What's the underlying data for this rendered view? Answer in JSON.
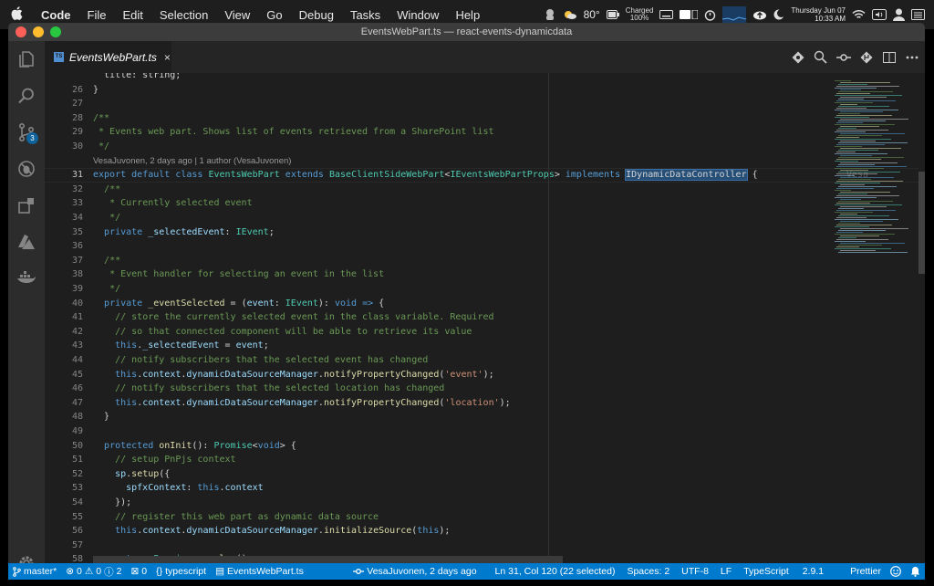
{
  "menubar": {
    "app": "Code",
    "items": [
      "File",
      "Edit",
      "Selection",
      "View",
      "Go",
      "Debug",
      "Tasks",
      "Window",
      "Help"
    ],
    "weather": "80°",
    "battery_status": "Charged",
    "battery_percent": "100%",
    "date": "Thursday Jun 07",
    "time": "10:33 AM"
  },
  "window": {
    "title": "EventsWebPart.ts — react-events-dynamicdata"
  },
  "activity": {
    "scm_badge": "3"
  },
  "tab": {
    "label": "EventsWebPart.ts",
    "icon_text": "TS",
    "close": "×"
  },
  "editor": {
    "codelens": "VesaJuvonen, 2 days ago | 1 author (VesaJuvonen)",
    "ghost_blame": "Vesa",
    "lines": [
      {
        "n": "",
        "tokens": [
          [
            "pu",
            "  title: string;"
          ]
        ]
      },
      {
        "n": "26",
        "tokens": [
          [
            "pu",
            "}"
          ]
        ]
      },
      {
        "n": "27",
        "tokens": []
      },
      {
        "n": "28",
        "tokens": [
          [
            "cm",
            "/**"
          ]
        ]
      },
      {
        "n": "29",
        "tokens": [
          [
            "cm",
            " * Events web part. Shows list of events retrieved from a SharePoint list"
          ]
        ]
      },
      {
        "n": "30",
        "tokens": [
          [
            "cm",
            " */"
          ]
        ]
      },
      {
        "n": "lens",
        "tokens": []
      },
      {
        "n": "31",
        "tokens": [
          [
            "kw",
            "export"
          ],
          [
            "pu",
            " "
          ],
          [
            "kw",
            "default"
          ],
          [
            "pu",
            " "
          ],
          [
            "kw",
            "class"
          ],
          [
            "pu",
            " "
          ],
          [
            "ty",
            "EventsWebPart"
          ],
          [
            "pu",
            " "
          ],
          [
            "kw",
            "extends"
          ],
          [
            "pu",
            " "
          ],
          [
            "ty",
            "BaseClientSideWebPart"
          ],
          [
            "pu",
            "<"
          ],
          [
            "ty",
            "IEventsWebPartProps"
          ],
          [
            "pu",
            "> "
          ],
          [
            "kw",
            "implements"
          ],
          [
            "pu",
            " "
          ],
          [
            "sel",
            "IDynamicDataController"
          ],
          [
            "pu",
            " {"
          ]
        ]
      },
      {
        "n": "32",
        "tokens": [
          [
            "pu",
            "  "
          ],
          [
            "cm",
            "/**"
          ]
        ]
      },
      {
        "n": "33",
        "tokens": [
          [
            "pu",
            "  "
          ],
          [
            "cm",
            " * Currently selected event"
          ]
        ]
      },
      {
        "n": "34",
        "tokens": [
          [
            "pu",
            "  "
          ],
          [
            "cm",
            " */"
          ]
        ]
      },
      {
        "n": "35",
        "tokens": [
          [
            "pu",
            "  "
          ],
          [
            "kw",
            "private"
          ],
          [
            "pu",
            " "
          ],
          [
            "vr",
            "_selectedEvent"
          ],
          [
            "pu",
            ": "
          ],
          [
            "ty",
            "IEvent"
          ],
          [
            "pu",
            ";"
          ]
        ]
      },
      {
        "n": "36",
        "tokens": []
      },
      {
        "n": "37",
        "tokens": [
          [
            "pu",
            "  "
          ],
          [
            "cm",
            "/**"
          ]
        ]
      },
      {
        "n": "38",
        "tokens": [
          [
            "pu",
            "  "
          ],
          [
            "cm",
            " * Event handler for selecting an event in the list"
          ]
        ]
      },
      {
        "n": "39",
        "tokens": [
          [
            "pu",
            "  "
          ],
          [
            "cm",
            " */"
          ]
        ]
      },
      {
        "n": "40",
        "tokens": [
          [
            "pu",
            "  "
          ],
          [
            "kw",
            "private"
          ],
          [
            "pu",
            " "
          ],
          [
            "fn",
            "_eventSelected"
          ],
          [
            "pu",
            " = ("
          ],
          [
            "vr",
            "event"
          ],
          [
            "pu",
            ": "
          ],
          [
            "ty",
            "IEvent"
          ],
          [
            "pu",
            "): "
          ],
          [
            "kw",
            "void"
          ],
          [
            "pu",
            " "
          ],
          [
            "kw",
            "=>"
          ],
          [
            "pu",
            " {"
          ]
        ]
      },
      {
        "n": "41",
        "tokens": [
          [
            "pu",
            "    "
          ],
          [
            "cm",
            "// store the currently selected event in the class variable. Required"
          ]
        ]
      },
      {
        "n": "42",
        "tokens": [
          [
            "pu",
            "    "
          ],
          [
            "cm",
            "// so that connected component will be able to retrieve its value"
          ]
        ]
      },
      {
        "n": "43",
        "tokens": [
          [
            "pu",
            "    "
          ],
          [
            "kw",
            "this"
          ],
          [
            "pu",
            "."
          ],
          [
            "vr",
            "_selectedEvent"
          ],
          [
            "pu",
            " = "
          ],
          [
            "vr",
            "event"
          ],
          [
            "pu",
            ";"
          ]
        ]
      },
      {
        "n": "44",
        "tokens": [
          [
            "pu",
            "    "
          ],
          [
            "cm",
            "// notify subscribers that the selected event has changed"
          ]
        ]
      },
      {
        "n": "45",
        "tokens": [
          [
            "pu",
            "    "
          ],
          [
            "kw",
            "this"
          ],
          [
            "pu",
            "."
          ],
          [
            "vr",
            "context"
          ],
          [
            "pu",
            "."
          ],
          [
            "vr",
            "dynamicDataSourceManager"
          ],
          [
            "pu",
            "."
          ],
          [
            "fn",
            "notifyPropertyChanged"
          ],
          [
            "pu",
            "("
          ],
          [
            "st",
            "'event'"
          ],
          [
            "pu",
            ");"
          ]
        ]
      },
      {
        "n": "46",
        "tokens": [
          [
            "pu",
            "    "
          ],
          [
            "cm",
            "// notify subscribers that the selected location has changed"
          ]
        ]
      },
      {
        "n": "47",
        "tokens": [
          [
            "pu",
            "    "
          ],
          [
            "kw",
            "this"
          ],
          [
            "pu",
            "."
          ],
          [
            "vr",
            "context"
          ],
          [
            "pu",
            "."
          ],
          [
            "vr",
            "dynamicDataSourceManager"
          ],
          [
            "pu",
            "."
          ],
          [
            "fn",
            "notifyPropertyChanged"
          ],
          [
            "pu",
            "("
          ],
          [
            "st",
            "'location'"
          ],
          [
            "pu",
            ");"
          ]
        ]
      },
      {
        "n": "48",
        "tokens": [
          [
            "pu",
            "  }"
          ]
        ]
      },
      {
        "n": "49",
        "tokens": []
      },
      {
        "n": "50",
        "tokens": [
          [
            "pu",
            "  "
          ],
          [
            "kw",
            "protected"
          ],
          [
            "pu",
            " "
          ],
          [
            "fn",
            "onInit"
          ],
          [
            "pu",
            "(): "
          ],
          [
            "ty",
            "Promise"
          ],
          [
            "pu",
            "<"
          ],
          [
            "kw",
            "void"
          ],
          [
            "pu",
            "> {"
          ]
        ]
      },
      {
        "n": "51",
        "tokens": [
          [
            "pu",
            "    "
          ],
          [
            "cm",
            "// setup PnPjs context"
          ]
        ]
      },
      {
        "n": "52",
        "tokens": [
          [
            "pu",
            "    "
          ],
          [
            "vr",
            "sp"
          ],
          [
            "pu",
            "."
          ],
          [
            "fn",
            "setup"
          ],
          [
            "pu",
            "({"
          ]
        ]
      },
      {
        "n": "53",
        "tokens": [
          [
            "pu",
            "      "
          ],
          [
            "vr",
            "spfxContext"
          ],
          [
            "pu",
            ": "
          ],
          [
            "kw",
            "this"
          ],
          [
            "pu",
            "."
          ],
          [
            "vr",
            "context"
          ]
        ]
      },
      {
        "n": "54",
        "tokens": [
          [
            "pu",
            "    });"
          ]
        ]
      },
      {
        "n": "55",
        "tokens": [
          [
            "pu",
            "    "
          ],
          [
            "cm",
            "// register this web part as dynamic data source"
          ]
        ]
      },
      {
        "n": "56",
        "tokens": [
          [
            "pu",
            "    "
          ],
          [
            "kw",
            "this"
          ],
          [
            "pu",
            "."
          ],
          [
            "vr",
            "context"
          ],
          [
            "pu",
            "."
          ],
          [
            "vr",
            "dynamicDataSourceManager"
          ],
          [
            "pu",
            "."
          ],
          [
            "fn",
            "initializeSource"
          ],
          [
            "pu",
            "("
          ],
          [
            "kw",
            "this"
          ],
          [
            "pu",
            ");"
          ]
        ]
      },
      {
        "n": "57",
        "tokens": []
      },
      {
        "n": "58",
        "tokens": [
          [
            "pu",
            "    "
          ],
          [
            "kw",
            "return"
          ],
          [
            "pu",
            " "
          ],
          [
            "ty",
            "Promise"
          ],
          [
            "pu",
            "."
          ],
          [
            "fn",
            "resolve"
          ],
          [
            "pu",
            "();"
          ]
        ]
      },
      {
        "n": "",
        "tokens": [
          [
            "pu",
            "  }"
          ]
        ]
      }
    ]
  },
  "status": {
    "branch": "master*",
    "errors": "0",
    "warnings": "0",
    "info": "2",
    "other": "0",
    "language_tag": "typescript",
    "file": "EventsWebPart.ts",
    "blame": "VesaJuvonen, 2 days ago",
    "position": "Ln 31, Col 120 (22 selected)",
    "spaces": "Spaces: 2",
    "encoding": "UTF-8",
    "eol": "LF",
    "language": "TypeScript",
    "version": "2.9.1",
    "formatter": "Prettier"
  },
  "colors": {
    "status_bar": "#007acc",
    "selection": "#264f78"
  }
}
